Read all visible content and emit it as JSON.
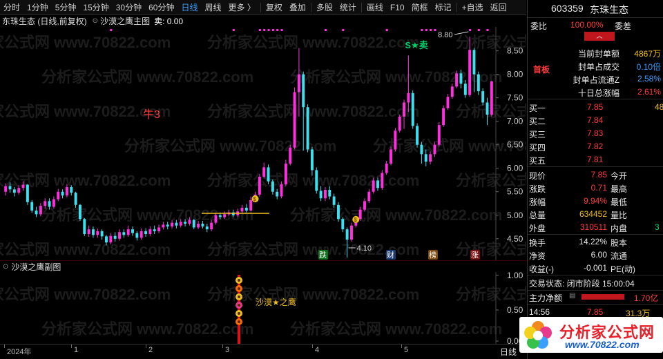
{
  "toolbar": {
    "items": [
      "分时",
      "1分钟",
      "5分钟",
      "15分钟",
      "30分钟",
      "60分钟",
      "日线",
      "周线",
      "更多 〉",
      "复权",
      "叠加",
      "多股",
      "统计",
      "画线",
      "F10",
      "简框",
      "标记",
      "+自选",
      "返回"
    ],
    "active_index": 6
  },
  "main_header": {
    "stock_label": "东珠生态 (日线,前复权)",
    "indicator_name": "沙漠之鹰主图",
    "sell_text": "卖: 0.00"
  },
  "annotations": {
    "bull_label": "牛3",
    "sell_signal": "S★卖",
    "high_label": "8.80",
    "low_label": "4.10",
    "badges": [
      "跌",
      "财",
      "榜",
      "涨"
    ]
  },
  "sub_header": {
    "name": "沙漠之鹰副图"
  },
  "sub_chart": {
    "label": "沙漠★之鹰",
    "y_ticks": [
      "1.00",
      "0.50",
      "0.00"
    ]
  },
  "y_axis_ticks": [
    "8.50",
    "8.00",
    "7.50",
    "7.00",
    "6.50",
    "6.00",
    "5.50",
    "5.00",
    "4.50"
  ],
  "date_axis": {
    "labels": [
      "2024年",
      "1",
      "2",
      "3",
      "4",
      "5"
    ],
    "period": "日线"
  },
  "watermark": "分析家公式网 www.70822.com",
  "colors": {
    "up": "#ff2fe0",
    "down": "#3ee0f0",
    "red": "#ff3b3b",
    "green": "#00d26a",
    "yellow": "#f0c020",
    "blue": "#3aa0ff"
  },
  "panel": {
    "code": "603359",
    "name": "东珠生态",
    "weibi_label": "委比",
    "weibi_value": "100.00%",
    "weicha_label": "委差",
    "board_label": "首板",
    "stats": [
      {
        "label": "当前封单额",
        "value": "4867万",
        "color": "yellow"
      },
      {
        "label": "封单占成交",
        "value": "0.10倍",
        "color": "blue"
      },
      {
        "label": "封单占流通Z",
        "value": "2.58%",
        "color": "blue"
      },
      {
        "label": "十日总涨幅",
        "value": "2.61%",
        "color": "red"
      }
    ],
    "bids": [
      {
        "label": "买一",
        "price": "7.85",
        "vol": "48"
      },
      {
        "label": "买二",
        "price": "7.84",
        "vol": ""
      },
      {
        "label": "买三",
        "price": "7.83",
        "vol": ""
      },
      {
        "label": "买四",
        "price": "7.82",
        "vol": ""
      },
      {
        "label": "买五",
        "price": "7.81",
        "vol": ""
      }
    ],
    "quote": [
      {
        "l1": "现价",
        "v1": "7.85",
        "l2": "今开",
        "v2": ""
      },
      {
        "l1": "涨跌",
        "v1": "0.71",
        "l2": "最高",
        "v2": ""
      },
      {
        "l1": "涨幅",
        "v1": "9.94%",
        "l2": "最低",
        "v2": ""
      },
      {
        "l1": "总量",
        "v1": "634452",
        "l2": "量比",
        "v2": ""
      },
      {
        "l1": "外盘",
        "v1": "310511",
        "l2": "内盘",
        "v2": "3"
      }
    ],
    "quote2": [
      {
        "l1": "换手",
        "v1": "14.22%",
        "l2": "股本"
      },
      {
        "l1": "净资",
        "v1": "6.00",
        "l2": "流通"
      },
      {
        "l1": "收益(-)",
        "v1": "-0.001",
        "l2": "PE(动)"
      }
    ],
    "trade_status": "交易状态: 闭市阶段 15:00:04",
    "net_flow_label": "主力净额",
    "net_flow_value": "1.70亿",
    "tick_time": "14:56",
    "tick_price": "7.85",
    "tick_vol": "31.3万"
  },
  "logo": {
    "text": "分析家公式网",
    "url": "www.70822.com"
  },
  "chart_data": {
    "type": "candlestick",
    "ylim": [
      4.1,
      8.95
    ],
    "candles": [
      [
        5.5,
        5.62,
        5.68,
        5.42
      ],
      [
        5.62,
        5.55,
        5.7,
        5.48
      ],
      [
        5.55,
        5.48,
        5.6,
        5.4
      ],
      [
        5.48,
        5.58,
        5.64,
        5.44
      ],
      [
        5.58,
        5.65,
        5.72,
        5.52
      ],
      [
        5.65,
        5.28,
        5.66,
        5.22
      ],
      [
        5.28,
        5.1,
        5.32,
        5.05
      ],
      [
        5.1,
        5.02,
        5.18,
        4.96
      ],
      [
        5.02,
        5.2,
        5.26,
        4.98
      ],
      [
        5.2,
        5.3,
        5.36,
        5.14
      ],
      [
        5.3,
        5.18,
        5.36,
        5.12
      ],
      [
        5.18,
        5.34,
        5.4,
        5.14
      ],
      [
        5.34,
        5.5,
        5.56,
        5.3
      ],
      [
        5.5,
        5.42,
        5.55,
        5.36
      ],
      [
        5.42,
        5.6,
        5.66,
        5.38
      ],
      [
        5.6,
        5.48,
        5.64,
        5.42
      ],
      [
        5.48,
        5.22,
        5.5,
        5.16
      ],
      [
        5.22,
        4.92,
        5.24,
        4.88
      ],
      [
        4.92,
        4.6,
        4.94,
        4.56
      ],
      [
        4.6,
        4.7,
        4.78,
        4.54
      ],
      [
        4.7,
        4.58,
        4.76,
        4.52
      ],
      [
        4.58,
        4.66,
        4.72,
        4.52
      ],
      [
        4.66,
        4.55,
        4.7,
        4.48
      ],
      [
        4.55,
        4.42,
        4.58,
        4.36
      ],
      [
        4.42,
        4.56,
        4.62,
        4.38
      ],
      [
        4.56,
        4.5,
        4.64,
        4.44
      ],
      [
        4.5,
        4.64,
        4.7,
        4.46
      ],
      [
        4.64,
        4.58,
        4.7,
        4.52
      ],
      [
        4.58,
        4.7,
        4.78,
        4.54
      ],
      [
        4.7,
        4.62,
        4.76,
        4.56
      ],
      [
        4.62,
        4.52,
        4.66,
        4.46
      ],
      [
        4.52,
        4.66,
        4.72,
        4.48
      ],
      [
        4.66,
        4.6,
        4.72,
        4.54
      ],
      [
        4.6,
        4.7,
        4.76,
        4.56
      ],
      [
        4.7,
        4.66,
        4.78,
        4.6
      ],
      [
        4.66,
        4.74,
        4.8,
        4.62
      ],
      [
        4.74,
        4.8,
        4.86,
        4.7
      ],
      [
        4.8,
        4.76,
        4.86,
        4.7
      ],
      [
        4.76,
        4.84,
        4.9,
        4.72
      ],
      [
        4.84,
        4.78,
        4.9,
        4.72
      ],
      [
        4.78,
        4.86,
        4.92,
        4.74
      ],
      [
        4.86,
        4.82,
        4.92,
        4.76
      ],
      [
        4.82,
        4.9,
        4.96,
        4.78
      ],
      [
        4.9,
        4.74,
        4.92,
        4.7
      ],
      [
        4.74,
        4.82,
        4.88,
        4.7
      ],
      [
        4.82,
        4.76,
        4.88,
        4.72
      ],
      [
        4.76,
        4.7,
        4.82,
        4.64
      ],
      [
        4.7,
        4.84,
        4.9,
        4.66
      ],
      [
        4.84,
        5.0,
        5.04,
        4.8
      ],
      [
        5.0,
        4.96,
        5.06,
        4.92
      ],
      [
        4.96,
        5.02,
        5.08,
        4.92
      ],
      [
        5.02,
        5.06,
        5.12,
        4.98
      ],
      [
        5.06,
        5.0,
        5.12,
        4.96
      ],
      [
        5.0,
        5.08,
        5.14,
        4.96
      ],
      [
        5.08,
        5.16,
        5.22,
        5.04
      ],
      [
        5.16,
        5.1,
        5.24,
        5.06
      ],
      [
        5.1,
        5.32,
        5.4,
        5.08
      ],
      [
        5.32,
        5.44,
        5.5,
        5.28
      ],
      [
        5.44,
        5.82,
        5.88,
        5.4
      ],
      [
        5.82,
        6.02,
        6.12,
        5.78
      ],
      [
        6.02,
        5.72,
        6.08,
        5.66
      ],
      [
        5.72,
        5.5,
        5.76,
        5.44
      ],
      [
        5.5,
        5.4,
        5.56,
        5.34
      ],
      [
        5.4,
        5.66,
        5.72,
        5.36
      ],
      [
        5.66,
        6.1,
        6.18,
        5.62
      ],
      [
        6.1,
        6.44,
        6.5,
        6.06
      ],
      [
        6.44,
        7.62,
        7.72,
        6.4
      ],
      [
        7.62,
        8.0,
        8.56,
        7.1
      ],
      [
        8.0,
        7.3,
        8.06,
        6.38
      ],
      [
        7.3,
        6.4,
        7.36,
        6.34
      ],
      [
        6.4,
        5.96,
        6.46,
        5.84
      ],
      [
        5.96,
        5.52,
        6.02,
        5.46
      ],
      [
        5.52,
        5.36,
        5.62,
        5.3
      ],
      [
        5.36,
        5.54,
        5.6,
        5.3
      ],
      [
        5.54,
        5.4,
        5.62,
        5.34
      ],
      [
        5.4,
        5.22,
        5.46,
        5.16
      ],
      [
        5.22,
        4.92,
        5.28,
        4.86
      ],
      [
        4.92,
        4.7,
        4.96,
        4.64
      ],
      [
        4.7,
        4.48,
        4.74,
        4.1
      ],
      [
        4.48,
        4.78,
        4.84,
        4.44
      ],
      [
        4.78,
        4.92,
        4.98,
        4.74
      ],
      [
        4.92,
        5.12,
        5.18,
        4.88
      ],
      [
        5.12,
        5.3,
        5.36,
        5.08
      ],
      [
        5.3,
        5.5,
        5.56,
        5.26
      ],
      [
        5.5,
        5.74,
        5.8,
        5.46
      ],
      [
        5.74,
        5.58,
        5.8,
        5.52
      ],
      [
        5.58,
        5.9,
        5.96,
        5.54
      ],
      [
        5.9,
        6.1,
        6.16,
        5.86
      ],
      [
        6.1,
        6.4,
        6.46,
        6.06
      ],
      [
        6.4,
        6.8,
        6.86,
        6.36
      ],
      [
        6.8,
        7.1,
        7.14,
        6.76
      ],
      [
        7.1,
        7.4,
        7.46,
        6.84
      ],
      [
        7.4,
        7.6,
        8.4,
        7.2
      ],
      [
        7.6,
        6.9,
        7.66,
        6.84
      ],
      [
        6.9,
        6.5,
        6.96,
        6.44
      ],
      [
        6.5,
        6.3,
        6.56,
        6.1
      ],
      [
        6.3,
        6.14,
        6.4,
        6.04
      ],
      [
        6.14,
        6.3,
        6.36,
        6.08
      ],
      [
        6.3,
        6.5,
        6.56,
        6.24
      ],
      [
        6.5,
        6.92,
        6.98,
        6.46
      ],
      [
        6.92,
        7.28,
        7.34,
        6.88
      ],
      [
        7.28,
        7.52,
        7.58,
        7.24
      ],
      [
        7.52,
        7.74,
        7.8,
        7.48
      ],
      [
        7.74,
        8.02,
        8.08,
        7.7
      ],
      [
        8.02,
        7.8,
        8.1,
        7.7
      ],
      [
        7.8,
        7.56,
        7.88,
        7.5
      ],
      [
        7.56,
        8.52,
        8.8,
        7.52
      ],
      [
        8.52,
        8.0,
        8.56,
        7.62
      ],
      [
        8.0,
        7.64,
        8.06,
        7.56
      ],
      [
        7.64,
        7.4,
        7.7,
        7.34
      ],
      [
        7.4,
        7.14,
        7.5,
        6.92
      ],
      [
        7.14,
        7.85,
        7.86,
        7.1
      ]
    ]
  }
}
